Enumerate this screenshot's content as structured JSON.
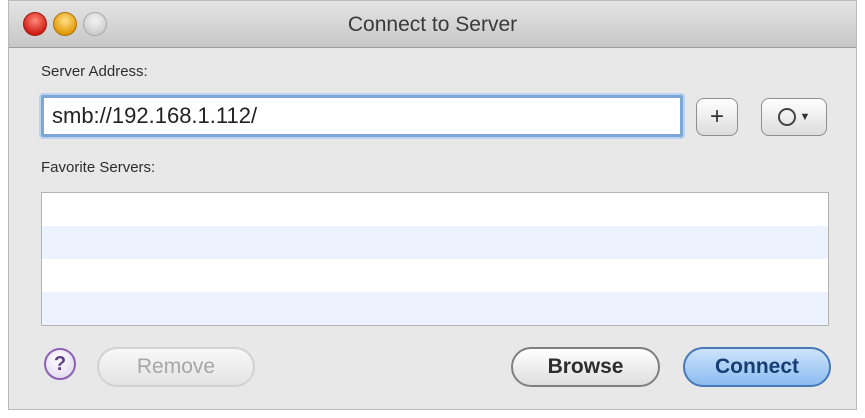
{
  "window": {
    "title": "Connect to Server"
  },
  "server_address": {
    "label": "Server Address:",
    "value": "smb://192.168.1.112/",
    "add_button": "+",
    "action_icon": "gear-menu-icon"
  },
  "favorites": {
    "label": "Favorite Servers:",
    "items": []
  },
  "buttons": {
    "help": "?",
    "remove": "Remove",
    "browse": "Browse",
    "connect": "Connect"
  },
  "colors": {
    "accent": "#7fa6d9",
    "default_button": "#8bbcf0"
  }
}
